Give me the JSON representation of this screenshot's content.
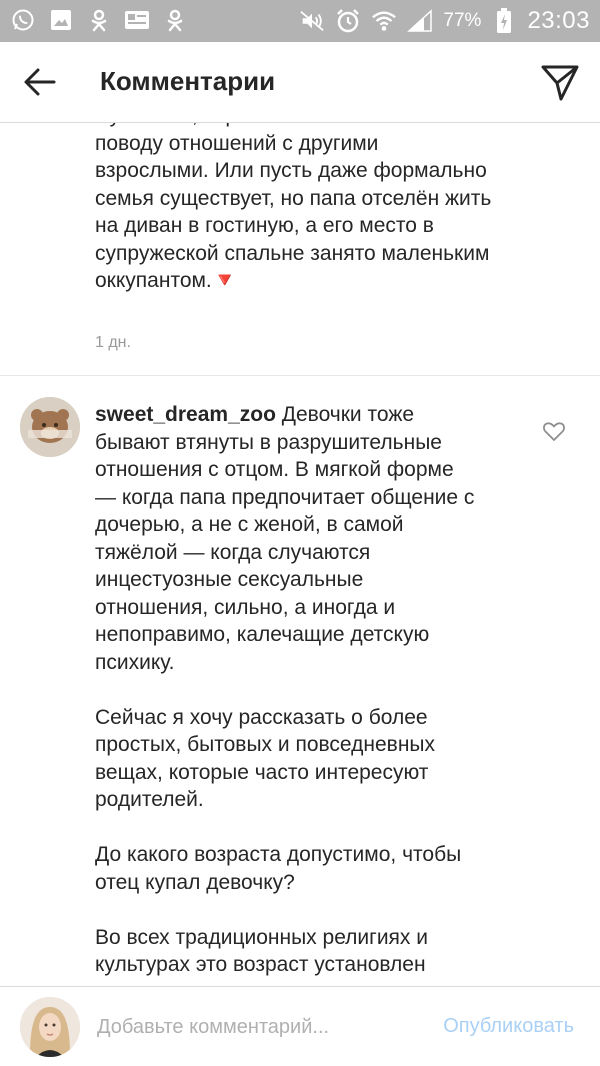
{
  "status_bar": {
    "battery_percent": "77%",
    "time": "23:03",
    "icons": [
      "whatsapp-icon",
      "gallery-icon",
      "odnoklassniki-icon",
      "news-icon",
      "odnoklassniki-icon",
      "mute-icon",
      "alarm-icon",
      "wifi-icon",
      "signal-icon",
      "battery-icon"
    ]
  },
  "header": {
    "title": "Комментарии",
    "back_icon": "arrow-left-icon",
    "send_icon": "paper-plane-icon"
  },
  "comments": [
    {
      "text": "мужчина», спрашивает его совета по\nповоду отношений с другими\nвзрослыми. Или пусть даже формально\nсемья существует, но папа отселён жить\nна диван в гостиную, а его место в\nсупружеской спальне занято маленьким\nоккупантом.",
      "emoji": "🔻",
      "time": "1 дн."
    },
    {
      "username": "sweet_dream_zoo",
      "text": " Девочки тоже\nбывают втянуты в разрушительные\nотношения с отцом. В мягкой форме\n— когда папа предпочитает общение с\nдочерью, а не с женой, в самой\nтяжёлой — когда случаются\nинцестуозные сексуальные\nотношения, сильно, а иногда и\nнепоправимо, калечащие детскую\nпсихику.\n\nСейчас я хочу рассказать о более\nпростых, бытовых и повседневных\nвещах, которые часто интересуют\nродителей.\n\nДо какого возраста допустимо, чтобы\nотец купал девочку?\n\nВо всех традиционных религиях и\nкультурах это возраст установлен",
      "like_icon": "heart-outline-icon"
    }
  ],
  "compose": {
    "placeholder": "Добавьте комментарий...",
    "post_label": "Опубликовать"
  },
  "colors": {
    "status_bar_bg": "#b3b3b3",
    "text": "#262626",
    "muted": "#999999",
    "post_disabled": "#a9d0f5",
    "divider": "#e6e6e6",
    "emoji_red": "#e0302f"
  }
}
